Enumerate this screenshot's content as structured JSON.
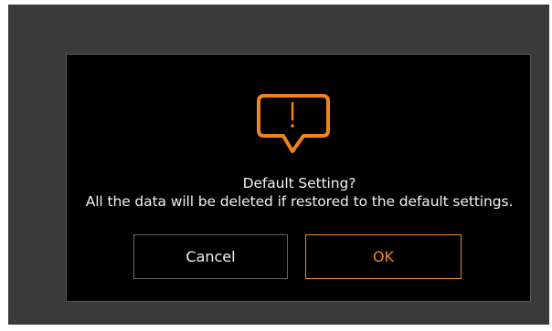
{
  "dialog": {
    "icon": "alert-speech-bubble-icon",
    "title": "Default Setting?",
    "message": "All the data will be deleted if restored to the default settings.",
    "cancel_label": "Cancel",
    "ok_label": "OK"
  },
  "colors": {
    "screen_background": "#3a3a3a",
    "dialog_background": "#000000",
    "accent": "#f0841c",
    "text": "#f2f2f2",
    "cancel_border": "#666666"
  }
}
